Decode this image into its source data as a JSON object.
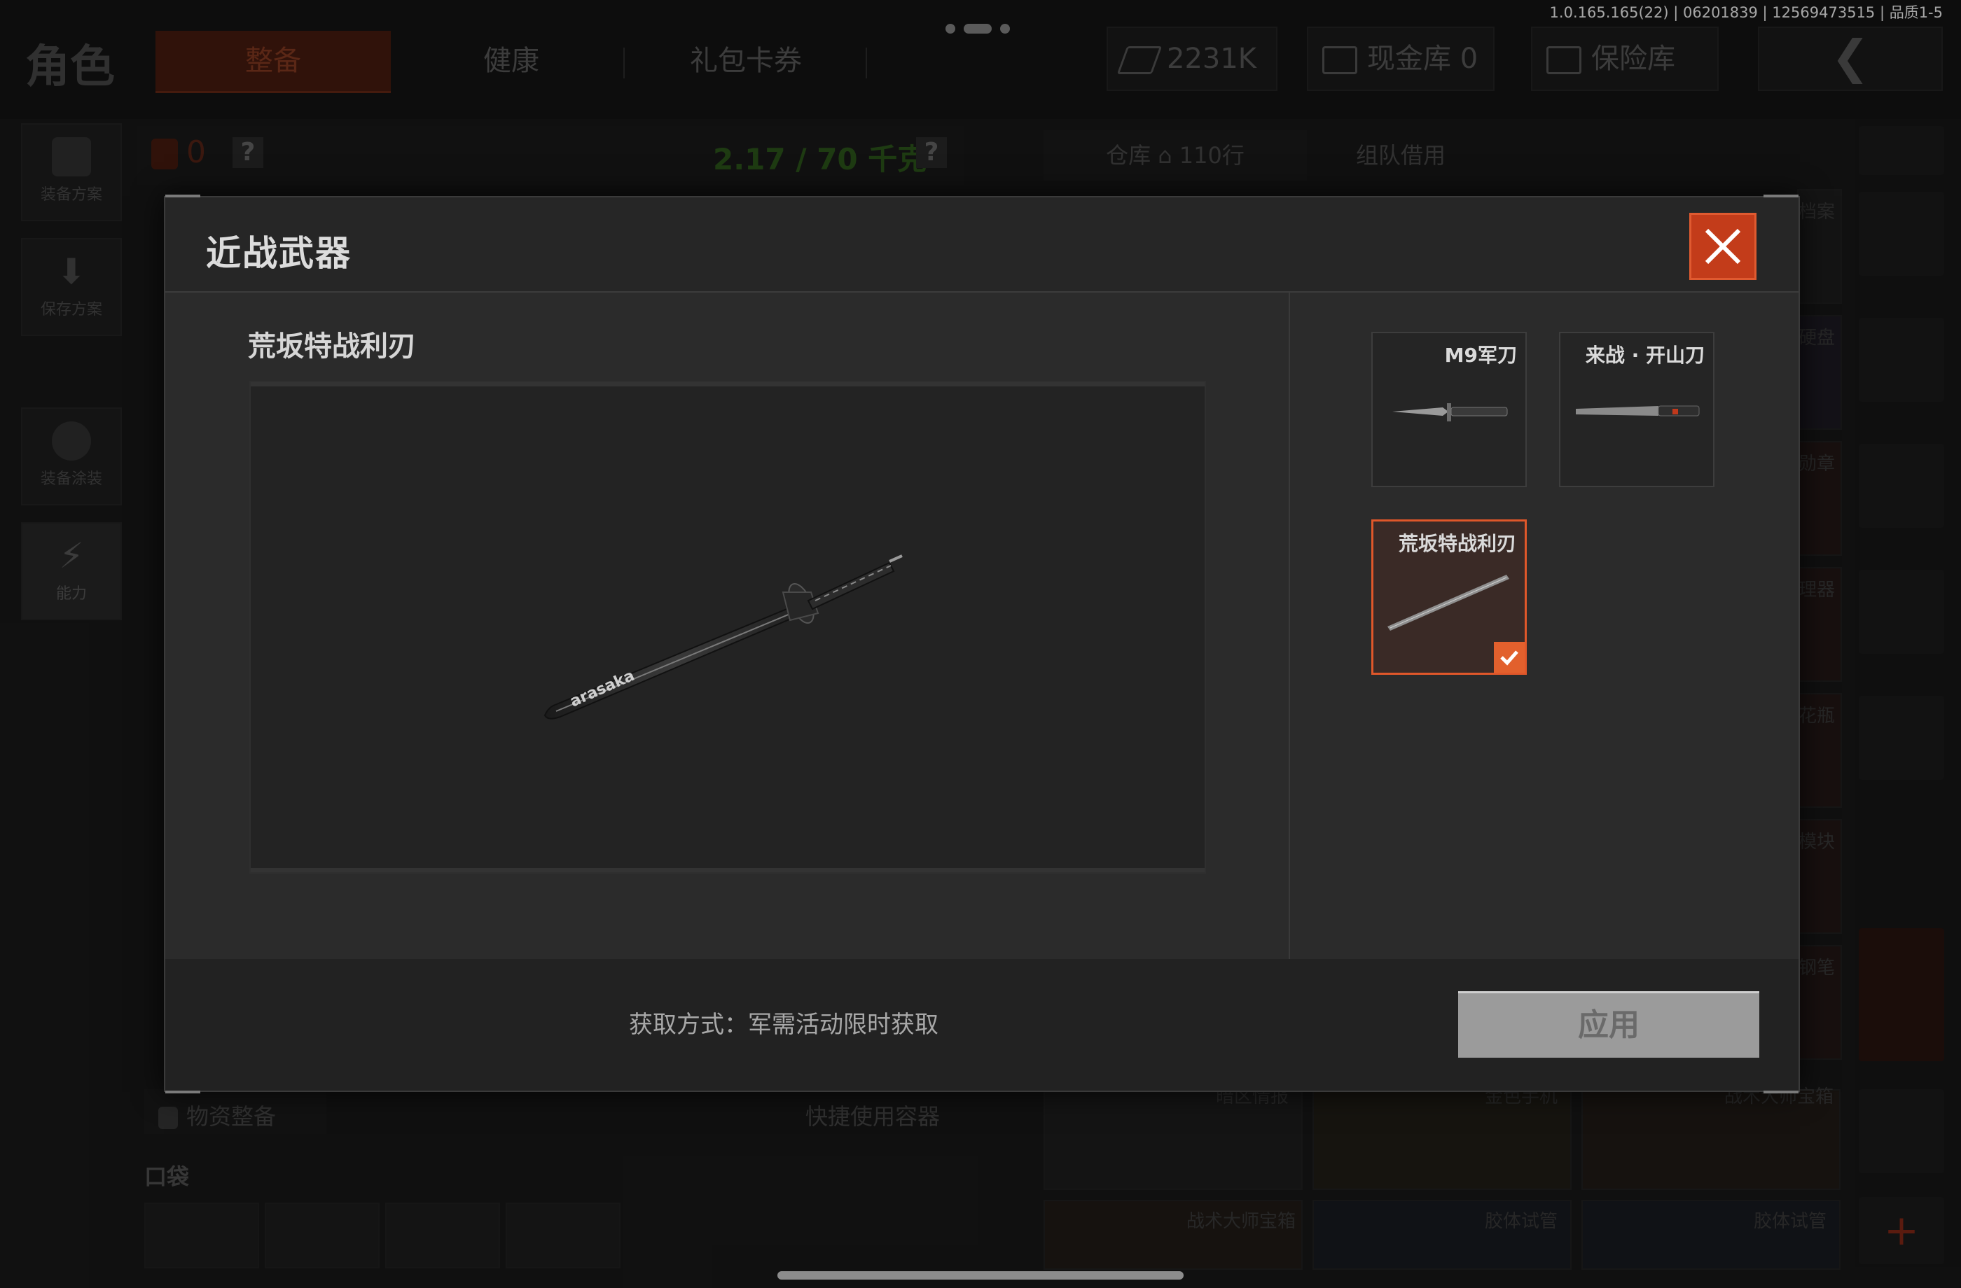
{
  "status": {
    "version_text": "1.0.165.165(22) | 06201839 | 12569473515 | 品质1-5"
  },
  "header": {
    "section_title": "角色",
    "tabs": [
      {
        "label": "整备",
        "active": true
      },
      {
        "label": "健康",
        "active": false
      },
      {
        "label": "礼包卡券",
        "active": false
      }
    ],
    "currency": "2231K",
    "cash_vault": "现金库 0",
    "safe_box": "保险库"
  },
  "sidebar": {
    "items": [
      {
        "label": "装备方案",
        "icon": "vest-icon"
      },
      {
        "label": "保存方案",
        "icon": "download-icon"
      },
      {
        "label": "装备涂装",
        "icon": "helmet-icon"
      },
      {
        "label": "能力",
        "icon": "lightning-icon"
      }
    ]
  },
  "inventory": {
    "backpack_count": "0",
    "weight": "2.17 / 70 千克",
    "help": "?",
    "warehouse_tab": "仓库",
    "warehouse_rows": "110行",
    "team_borrow": "组队借用",
    "supply_section": "物资整备",
    "quick_container": "快捷使用容器",
    "pocket": "口袋"
  },
  "background_items": {
    "labels": [
      "档案",
      "硬盘",
      "勋章",
      "理器",
      "花瓶",
      "模块",
      "钢笔"
    ],
    "bottom_row": [
      "暗区情报",
      "金色手机",
      "战术大师宝箱",
      "战术大师宝箱",
      "胶体试管",
      "胶体试管"
    ]
  },
  "modal": {
    "title": "近战武器",
    "selected_name": "荒坂特战利刃",
    "weapons": [
      {
        "name": "M9军刀",
        "icon": "combat-knife-icon",
        "selected": false
      },
      {
        "name": "来战 · 开山刀",
        "icon": "machete-icon",
        "selected": false
      },
      {
        "name": "荒坂特战利刃",
        "icon": "katana-icon",
        "selected": true
      }
    ],
    "acquire_text": "获取方式：军需活动限时获取",
    "apply_label": "应用",
    "preview_engraving": "arasaka"
  },
  "colors": {
    "accent": "#e0572a",
    "close_bg": "#c33c1a",
    "weight_green": "#2f5b1d"
  }
}
